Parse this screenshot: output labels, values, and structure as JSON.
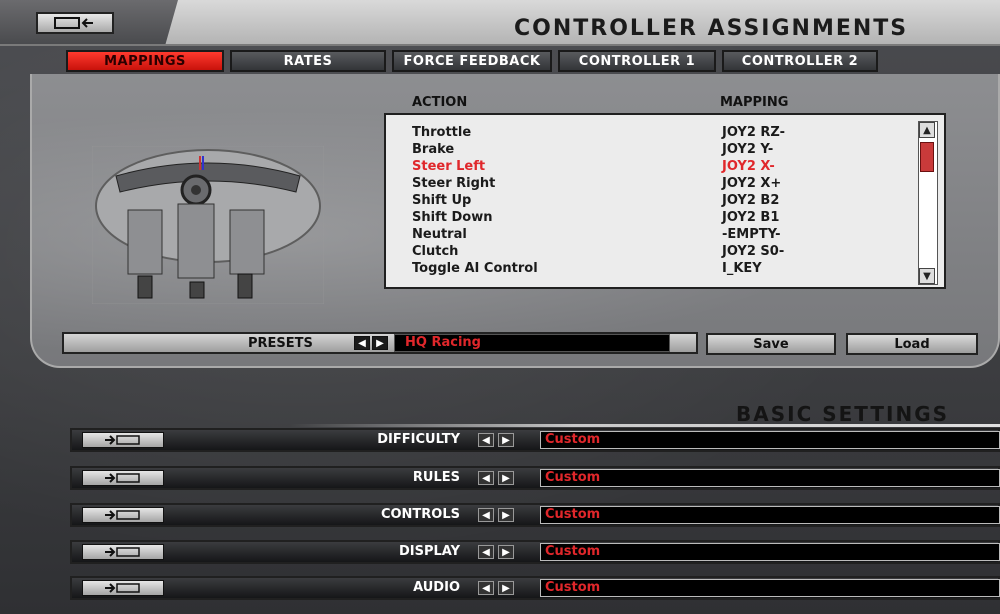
{
  "header": {
    "title": "CONTROLLER ASSIGNMENTS",
    "back_icon": "back-arrow-icon"
  },
  "tabs": [
    {
      "label": "MAPPINGS",
      "active": true
    },
    {
      "label": "RATES",
      "active": false
    },
    {
      "label": "FORCE FEEDBACK",
      "active": false
    },
    {
      "label": "CONTROLLER 1",
      "active": false
    },
    {
      "label": "CONTROLLER 2",
      "active": false
    }
  ],
  "table": {
    "col_action": "ACTION",
    "col_mapping": "MAPPING",
    "rows": [
      {
        "action": "Throttle",
        "mapping": "JOY2 RZ-"
      },
      {
        "action": "Brake",
        "mapping": "JOY2 Y-"
      },
      {
        "action": "Steer Left",
        "mapping": "JOY2 X-"
      },
      {
        "action": "Steer Right",
        "mapping": "JOY2 X+"
      },
      {
        "action": "Shift Up",
        "mapping": "JOY2 B2"
      },
      {
        "action": "Shift Down",
        "mapping": "JOY2 B1"
      },
      {
        "action": "Neutral",
        "mapping": "-EMPTY-"
      },
      {
        "action": "Clutch",
        "mapping": "JOY2 S0-"
      },
      {
        "action": "Toggle AI Control",
        "mapping": "I_KEY"
      }
    ],
    "selected_index": 2
  },
  "presets": {
    "label": "PRESETS",
    "value": "HQ Racing",
    "save_label": "Save",
    "load_label": "Load"
  },
  "basic_settings": {
    "title": "BASIC SETTINGS",
    "rows": [
      {
        "label": "DIFFICULTY",
        "value": "Custom"
      },
      {
        "label": "RULES",
        "value": "Custom"
      },
      {
        "label": "CONTROLS",
        "value": "Custom"
      },
      {
        "label": "DISPLAY",
        "value": "Custom"
      },
      {
        "label": "AUDIO",
        "value": "Custom"
      }
    ]
  },
  "colors": {
    "accent_red": "#e0272b",
    "tab_active": "#d8170f"
  }
}
